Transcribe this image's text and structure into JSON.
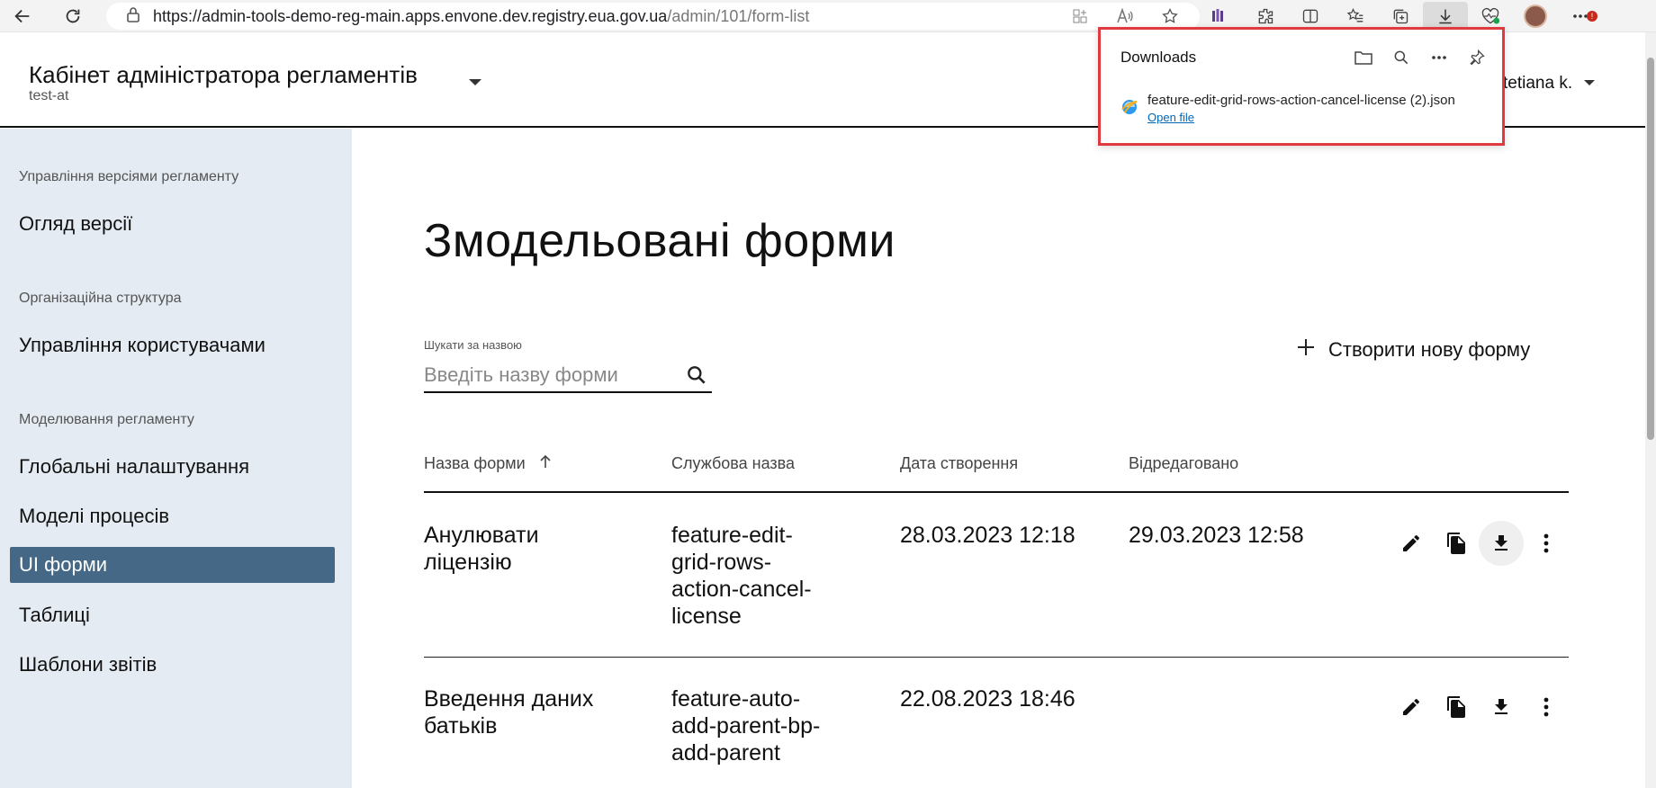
{
  "browser": {
    "url_host": "https://admin-tools-demo-reg-main.apps.envone.dev.registry.eua.gov.ua",
    "url_path": "/admin/101/form-list"
  },
  "header": {
    "title": "Кабінет адміністратора регламентів",
    "subtitle": "test-at",
    "user": "tetiana k."
  },
  "downloads": {
    "title": "Downloads",
    "filename": "feature-edit-grid-rows-action-cancel-license (2).json",
    "open_label": "Open file"
  },
  "sidebar": {
    "sections": [
      {
        "title": "Управління версіями регламенту",
        "items": [
          "Огляд версії"
        ]
      },
      {
        "title": "Організаційна структура",
        "items": [
          "Управління користувачами"
        ]
      },
      {
        "title": "Моделювання регламенту",
        "items": [
          "Глобальні налаштування",
          "Моделі процесів",
          "UI форми",
          "Таблиці",
          "Шаблони звітів"
        ]
      }
    ],
    "active_item": "UI форми"
  },
  "main": {
    "title": "Змодельовані форми",
    "search": {
      "label": "Шукати за назвою",
      "placeholder": "Введіть назву форми",
      "value": ""
    },
    "create_label": "Створити нову форму",
    "columns": [
      "Назва форми",
      "Службова назва",
      "Дата створення",
      "Відредаговано"
    ],
    "rows": [
      {
        "name": [
          "Анулювати",
          "ліцензію"
        ],
        "service": [
          "feature-edit-",
          "grid-rows-",
          "action-cancel-",
          "license"
        ],
        "created": "28.03.2023 12:18",
        "edited": "29.03.2023 12:58"
      },
      {
        "name": [
          "Введення даних",
          "батьків"
        ],
        "service": [
          "feature-auto-",
          "add-parent-bp-",
          "add-parent"
        ],
        "created": "22.08.2023 18:46",
        "edited": ""
      }
    ]
  },
  "icons": [
    "back-icon",
    "refresh-icon",
    "lock-icon",
    "apps-icon",
    "read-aloud-icon",
    "favorite-icon",
    "extension-icon",
    "split-icon",
    "favorites-list-icon",
    "collections-icon",
    "download-icon",
    "health-icon",
    "more-icon",
    "folder-icon",
    "search-icon",
    "pin-icon",
    "edit-icon",
    "copy-icon",
    "kebab-icon",
    "plus-icon",
    "sort-up-icon"
  ],
  "colors": {
    "sidebar_bg": "#e4ebf2",
    "active_item": "#466887",
    "highlight_border": "#e0393e",
    "link": "#0067b8"
  }
}
